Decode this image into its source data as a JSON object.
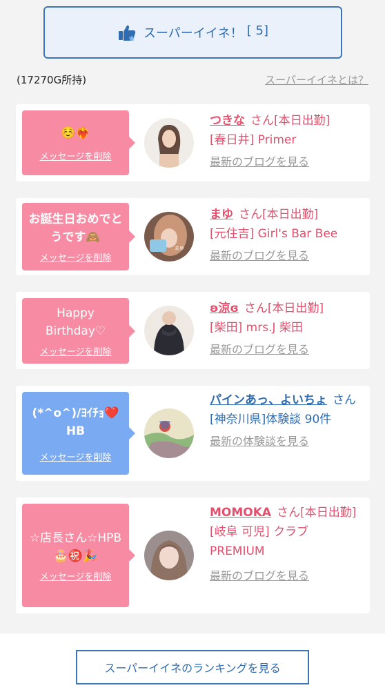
{
  "super_like_button": {
    "label": "スーパーイイネ！",
    "count": "[ 5]"
  },
  "balance": "(17270G所持)",
  "what_is_link": "スーパーイイネとは？",
  "delete_label": "メッセージを削除",
  "cards": [
    {
      "message": "☺️❤️‍🔥",
      "name": "つきな",
      "suffix": "さん[本日出勤]",
      "line2": "[春日井] Primer",
      "link": "最新のブログを見る",
      "colors": {
        "bubble": "#f88ba4",
        "text": "#e2506e"
      }
    },
    {
      "message": "お誕生日おめでとうです🙈",
      "name": "まゆ",
      "suffix": "さん[本日出勤]",
      "line2": "[元住吉] Girl's Bar Bee",
      "link": "最新のブログを見る"
    },
    {
      "message": "Happy Birthday♡",
      "name": "ʚ涼ɞ",
      "suffix": "さん[本日出勤]",
      "line2": "[柴田] mrs.J 柴田",
      "link": "最新のブログを見る"
    },
    {
      "message": "(*^o^)/ﾖｲﾁｮ❤️ HB",
      "name": "パインあっ、よいちょ",
      "suffix": "さん",
      "line2": "[神奈川県]体験談 90件",
      "link": "最新の体験談を見る",
      "colors": {
        "bubble": "#7aaaf2",
        "text": "#2f6cb0"
      }
    },
    {
      "message": "☆店長さん☆HPB 🎂㊗️🎉",
      "name": "MOMOKA",
      "suffix": "さん[本日出勤]",
      "line2": "[岐阜 可児] クラブ PREMIUM",
      "link": "最新のブログを見る"
    }
  ],
  "ranking_button": "スーパーイイネのランキングを見る"
}
